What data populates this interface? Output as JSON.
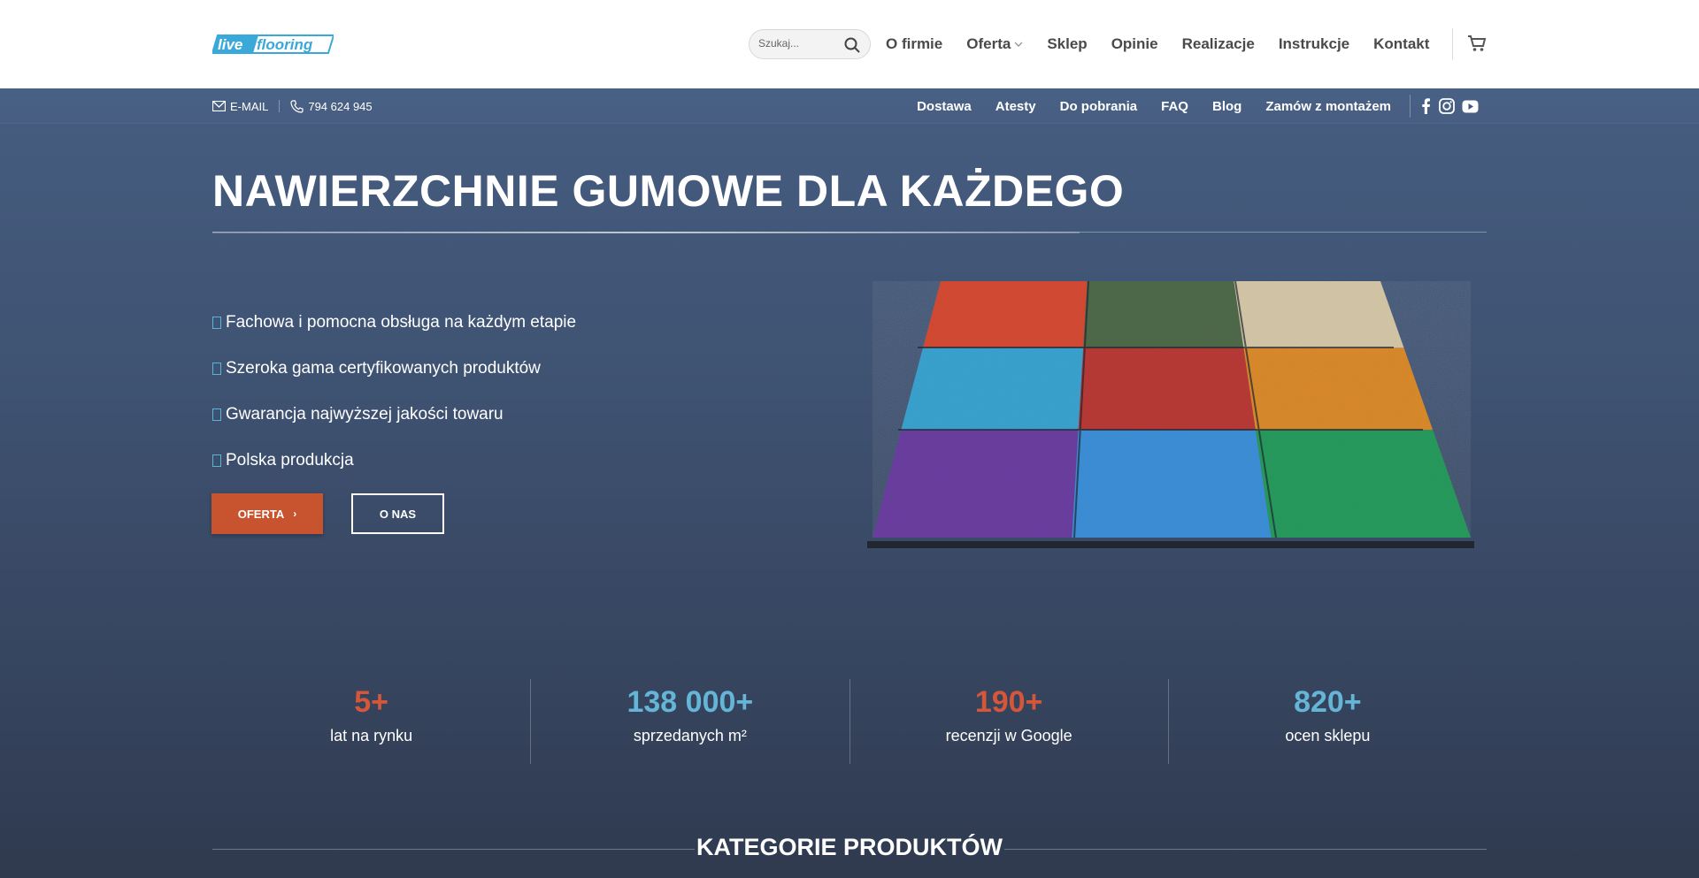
{
  "header": {
    "logo_text": "live flooring",
    "search": {
      "placeholder": "Szukaj..."
    },
    "nav": [
      {
        "label": "O firmie"
      },
      {
        "label": "Oferta"
      },
      {
        "label": "Sklep"
      },
      {
        "label": "Opinie"
      },
      {
        "label": "Realizacje"
      },
      {
        "label": "Instrukcje"
      },
      {
        "label": "Kontakt"
      }
    ]
  },
  "topbar": {
    "email_label": "E-MAIL",
    "phone": "794 624 945",
    "nav": [
      {
        "label": "Dostawa"
      },
      {
        "label": "Atesty"
      },
      {
        "label": "Do pobrania"
      },
      {
        "label": "FAQ"
      },
      {
        "label": "Blog"
      },
      {
        "label": "Zamów z montażem"
      }
    ],
    "social_icons": [
      "facebook-icon",
      "instagram-icon",
      "youtube-icon"
    ]
  },
  "hero": {
    "title": "NAWIERZCHNIE GUMOWE DLA KAŻDEGO",
    "features": [
      "Fachowa i pomocna obsługa na każdym etapie",
      "Szeroka gama certyfikowanych produktów",
      "Gwarancja najwyższej jakości towaru",
      "Polska produkcja"
    ],
    "buttons": {
      "primary": "OFERTA",
      "secondary": "O NAS"
    },
    "tile_colors": [
      "#d34a33",
      "#4f6a4a",
      "#d4c7a8",
      "#3aa3cf",
      "#b83a35",
      "#d98a2a",
      "#6b3fa0",
      "#3b8fd6",
      "#279a5c"
    ]
  },
  "stats": [
    {
      "value": "5+",
      "label": "lat na rynku",
      "color": "orange"
    },
    {
      "value": "138 000+",
      "label": "sprzedanych m²",
      "color": "blue"
    },
    {
      "value": "190+",
      "label": "recenzji w Google",
      "color": "orange"
    },
    {
      "value": "820+",
      "label": "ocen sklepu",
      "color": "blue"
    }
  ],
  "categories": {
    "title": "KATEGORIE PRODUKTÓW"
  },
  "colors": {
    "accent_orange": "#c8532f",
    "accent_blue": "#64b5d6",
    "logo_blue": "#3aa8d8"
  }
}
